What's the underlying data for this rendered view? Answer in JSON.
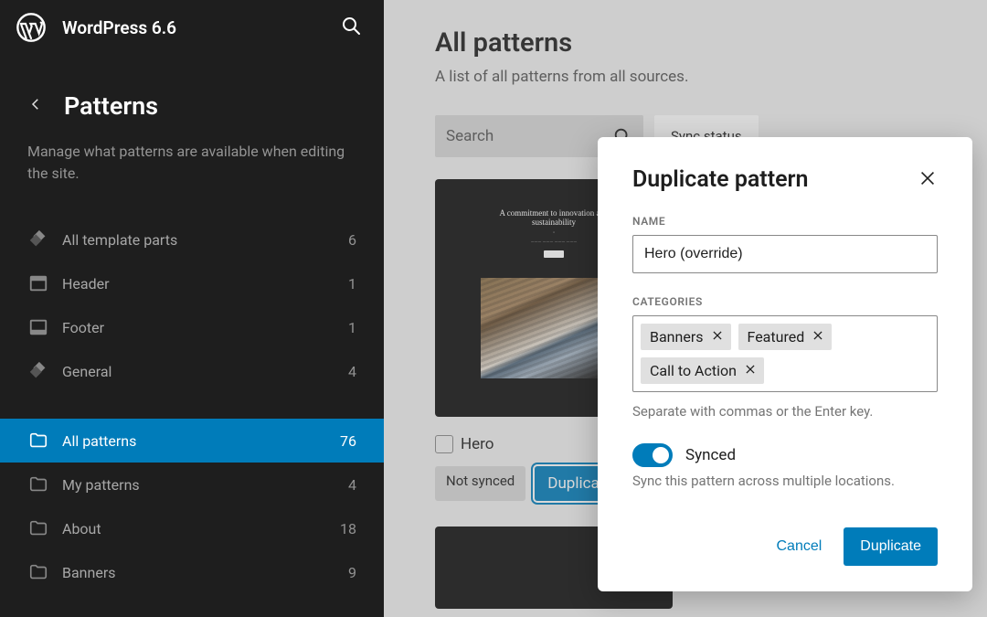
{
  "header": {
    "site_title": "WordPress 6.6"
  },
  "sidebar": {
    "title": "Patterns",
    "description": "Manage what patterns are available when editing the site.",
    "template_parts": [
      {
        "label": "All template parts",
        "count": 6,
        "icon": "diamond-stack-icon"
      },
      {
        "label": "Header",
        "count": 1,
        "icon": "header-layout-icon"
      },
      {
        "label": "Footer",
        "count": 1,
        "icon": "footer-layout-icon"
      },
      {
        "label": "General",
        "count": 4,
        "icon": "diamond-stack-icon"
      }
    ],
    "categories": [
      {
        "label": "All patterns",
        "count": 76,
        "active": true
      },
      {
        "label": "My patterns",
        "count": 4
      },
      {
        "label": "About",
        "count": 18
      },
      {
        "label": "Banners",
        "count": 9
      }
    ]
  },
  "main": {
    "title": "All patterns",
    "subtitle": "A list of all patterns from all sources.",
    "search_placeholder": "Search",
    "sync_filter_label": "Sync status",
    "pattern": {
      "name": "Hero",
      "not_synced_label": "Not synced",
      "duplicate_tooltip": "Duplicate",
      "preview_heading": "A commitment to innovation and sustainability"
    }
  },
  "modal": {
    "title": "Duplicate pattern",
    "name_label": "NAME",
    "name_value": "Hero (override)",
    "categories_label": "CATEGORIES",
    "tags": [
      "Banners",
      "Featured",
      "Call to Action"
    ],
    "categories_help": "Separate with commas or the Enter key.",
    "synced_label": "Synced",
    "synced_help": "Sync this pattern across multiple locations.",
    "cancel_label": "Cancel",
    "confirm_label": "Duplicate"
  }
}
